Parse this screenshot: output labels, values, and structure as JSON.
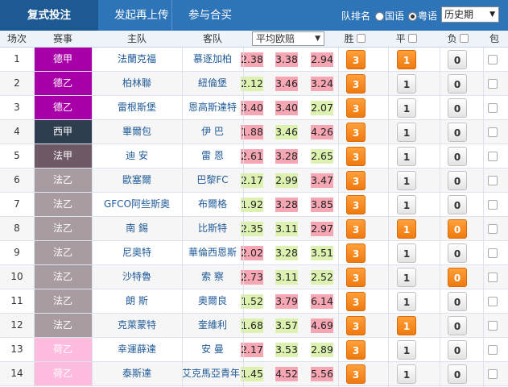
{
  "tabs": {
    "active": "复式投注",
    "second": "发起再上传",
    "third": "参与合买"
  },
  "sort": {
    "label": "队排名",
    "mandarin": "国语",
    "cantonese": "粤语",
    "period": "历史期"
  },
  "header": {
    "idx": "场次",
    "league": "赛事",
    "home": "主队",
    "away": "客队",
    "avg": "平均欧赔",
    "win": "胜",
    "draw": "平",
    "loss": "负",
    "bank": "包"
  },
  "colors": {
    "bundesliga": "#a800a8",
    "bundesliga2": "#a800a8",
    "laliga": "#2e3e4f",
    "ligue1": "#6e5a66",
    "ligue2": "#a89ca0",
    "eredivisie2": "#ffbcdf",
    "orange": "#f28a1e"
  },
  "rows": [
    {
      "n": "1",
      "league": "德甲",
      "lc": "#a800a8",
      "home": "法蘭克福",
      "away": "慕逐加柏",
      "o": [
        "2.38",
        "3.38",
        "2.94"
      ],
      "oc": [
        "pk",
        "pk",
        "pk"
      ],
      "w": "3",
      "d": "1",
      "l": "0",
      "sel": [
        "w",
        "d"
      ]
    },
    {
      "n": "2",
      "league": "德乙",
      "lc": "#a800a8",
      "home": "柏林聯",
      "away": "紐倫堡",
      "o": [
        "2.12",
        "3.46",
        "3.24"
      ],
      "oc": [
        "gr",
        "pk",
        "pk"
      ],
      "w": "3",
      "d": "1",
      "l": "0",
      "sel": [
        "w"
      ]
    },
    {
      "n": "3",
      "league": "德乙",
      "lc": "#a800a8",
      "home": "雷根斯堡",
      "away": "恩高斯達特",
      "o": [
        "3.40",
        "3.40",
        "2.07"
      ],
      "oc": [
        "pk",
        "pk",
        "gr"
      ],
      "w": "3",
      "d": "1",
      "l": "0",
      "sel": [
        "w"
      ]
    },
    {
      "n": "4",
      "league": "西甲",
      "lc": "#2e3e4f",
      "home": "畢爾包",
      "away": "伊 巴",
      "o": [
        "1.88",
        "3.46",
        "4.26"
      ],
      "oc": [
        "pk",
        "gr",
        "pk"
      ],
      "w": "3",
      "d": "1",
      "l": "0",
      "sel": [
        "w"
      ]
    },
    {
      "n": "5",
      "league": "法甲",
      "lc": "#6e5a66",
      "home": "迪 安",
      "away": "雷 恩",
      "o": [
        "2.61",
        "3.28",
        "2.65"
      ],
      "oc": [
        "pk",
        "pk",
        "gr"
      ],
      "w": "3",
      "d": "1",
      "l": "0",
      "sel": [
        "w"
      ]
    },
    {
      "n": "6",
      "league": "法乙",
      "lc": "#a89ca0",
      "home": "歐塞爾",
      "away": "巴黎FC",
      "o": [
        "2.17",
        "2.99",
        "3.47"
      ],
      "oc": [
        "gr",
        "gr",
        "pk"
      ],
      "w": "3",
      "d": "1",
      "l": "0",
      "sel": [
        "w"
      ]
    },
    {
      "n": "7",
      "league": "法乙",
      "lc": "#a89ca0",
      "home": "GFCO阿些斯奧",
      "away": "布爾格",
      "o": [
        "1.92",
        "3.28",
        "3.85"
      ],
      "oc": [
        "gr",
        "pk",
        "pk"
      ],
      "w": "3",
      "d": "1",
      "l": "0",
      "sel": [
        "w"
      ]
    },
    {
      "n": "8",
      "league": "法乙",
      "lc": "#a89ca0",
      "home": "南 錫",
      "away": "比斯特",
      "o": [
        "2.35",
        "3.11",
        "2.97"
      ],
      "oc": [
        "gr",
        "gr",
        "pk"
      ],
      "w": "3",
      "d": "1",
      "l": "0",
      "sel": [
        "w",
        "d",
        "l"
      ]
    },
    {
      "n": "9",
      "league": "法乙",
      "lc": "#a89ca0",
      "home": "尼奧特",
      "away": "華倫西恩斯",
      "o": [
        "2.02",
        "3.28",
        "3.51"
      ],
      "oc": [
        "pk",
        "gr",
        "gr"
      ],
      "w": "3",
      "d": "1",
      "l": "0",
      "sel": [
        "w"
      ]
    },
    {
      "n": "10",
      "league": "法乙",
      "lc": "#a89ca0",
      "home": "沙特魯",
      "away": "索 察",
      "o": [
        "2.73",
        "3.11",
        "2.52"
      ],
      "oc": [
        "pk",
        "gr",
        "gr"
      ],
      "w": "3",
      "d": "1",
      "l": "0",
      "sel": [
        "w",
        "l"
      ]
    },
    {
      "n": "11",
      "league": "法乙",
      "lc": "#a89ca0",
      "home": "朗 斯",
      "away": "奧爾良",
      "o": [
        "1.52",
        "3.79",
        "6.14"
      ],
      "oc": [
        "gr",
        "pk",
        "pk"
      ],
      "w": "3",
      "d": "1",
      "l": "0",
      "sel": [
        "w"
      ]
    },
    {
      "n": "12",
      "league": "法乙",
      "lc": "#a89ca0",
      "home": "克萊蒙特",
      "away": "奎維利",
      "o": [
        "1.68",
        "3.57",
        "4.69"
      ],
      "oc": [
        "gr",
        "gr",
        "pk"
      ],
      "w": "3",
      "d": "1",
      "l": "0",
      "sel": [
        "w",
        "d"
      ]
    },
    {
      "n": "13",
      "league": "荷乙",
      "lc": "#ffbcdf",
      "home": "幸運薛達",
      "away": "安 曼",
      "o": [
        "2.17",
        "3.53",
        "2.89"
      ],
      "oc": [
        "pk",
        "gr",
        "gr"
      ],
      "w": "3",
      "d": "1",
      "l": "0",
      "sel": [
        "w"
      ]
    },
    {
      "n": "14",
      "league": "荷乙",
      "lc": "#ffbcdf",
      "home": "泰斯達",
      "away": "艾克馬亞青年隊",
      "o": [
        "1.45",
        "4.52",
        "5.56"
      ],
      "oc": [
        "gr",
        "pk",
        "pk"
      ],
      "w": "3",
      "d": "1",
      "l": "0",
      "sel": [
        "w"
      ]
    }
  ]
}
